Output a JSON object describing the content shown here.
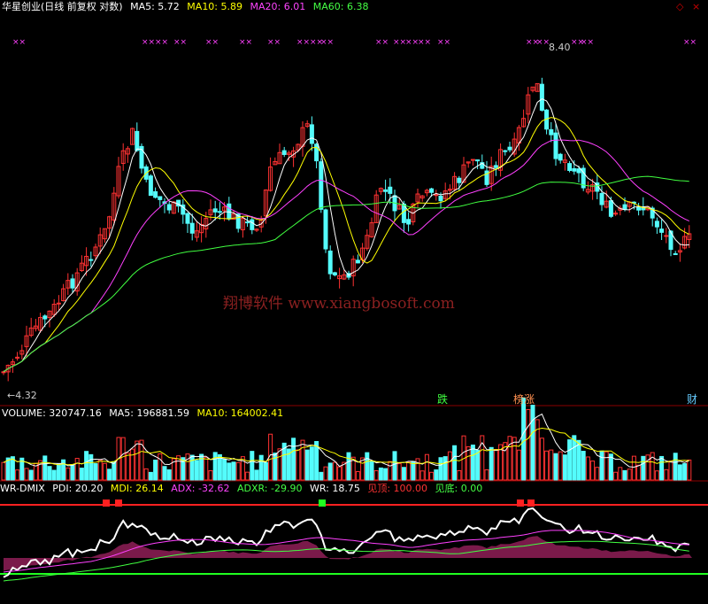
{
  "main": {
    "title": "华星创业(日线 前复权 对数)",
    "ma_labels": [
      {
        "text": "MA5: 5.72",
        "color": "#ffffff"
      },
      {
        "text": "MA10: 5.89",
        "color": "#ffff00"
      },
      {
        "text": "MA20: 6.01",
        "color": "#ff40ff"
      },
      {
        "text": "MA60: 6.38",
        "color": "#40ff40"
      }
    ],
    "high_label": "8.40",
    "low_label": "←4.32",
    "high_value": 8.4,
    "low_value": 4.32,
    "watermark": "翔博软件 www.xiangbosoft.com",
    "markers": [
      {
        "text": "跌",
        "color": "#40ff40"
      },
      {
        "text": "榜涨",
        "color": "#ff9050"
      },
      {
        "text": "财",
        "color": "#66ccff"
      }
    ],
    "cross_glyph": "××"
  },
  "volume": {
    "labels": [
      {
        "text": "VOLUME: 320747.16",
        "color": "#ffffff"
      },
      {
        "text": "MA5: 196881.59",
        "color": "#ffffff"
      },
      {
        "text": "MA10: 164002.41",
        "color": "#ffff00"
      }
    ]
  },
  "indicator": {
    "labels": [
      {
        "text": "WR-DMIX",
        "color": "#ffffff"
      },
      {
        "text": "PDI: 20.20",
        "color": "#ffffff"
      },
      {
        "text": "MDI: 26.14",
        "color": "#ffff00"
      },
      {
        "text": "ADX: -32.62",
        "color": "#ff40ff"
      },
      {
        "text": "ADXR: -29.90",
        "color": "#40ff40"
      },
      {
        "text": "WR: 18.75",
        "color": "#ffffff"
      },
      {
        "text": "见顶: 100.00",
        "color": "#ff3030"
      },
      {
        "text": "见底: 0.00",
        "color": "#40ff40"
      }
    ]
  },
  "controls": {
    "prev": "◇",
    "close": "×"
  },
  "colors": {
    "up": "#ff3232",
    "down": "#54fcfc",
    "ma5": "#ffffff",
    "ma10": "#ffff00",
    "ma20": "#ff40ff",
    "ma60": "#40ff40",
    "grid": "#8b0000"
  }
}
